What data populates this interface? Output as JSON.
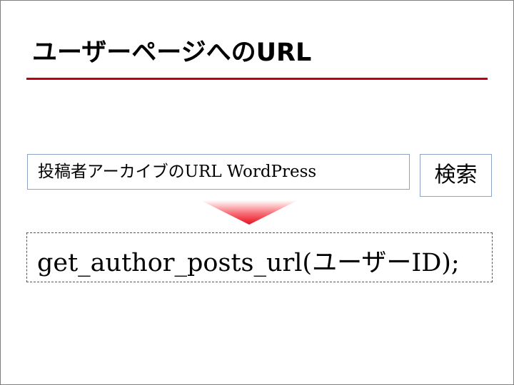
{
  "slide": {
    "title": "ユーザーページへのURL",
    "accent_color": "#c0000f"
  },
  "search": {
    "query": "投稿者アーカイブのURL WordPress",
    "button_label": "検索"
  },
  "arrow": {
    "icon": "down-arrow-icon",
    "color": "#e8101e"
  },
  "code": {
    "text": "get_author_posts_url(ユーザーID);"
  }
}
